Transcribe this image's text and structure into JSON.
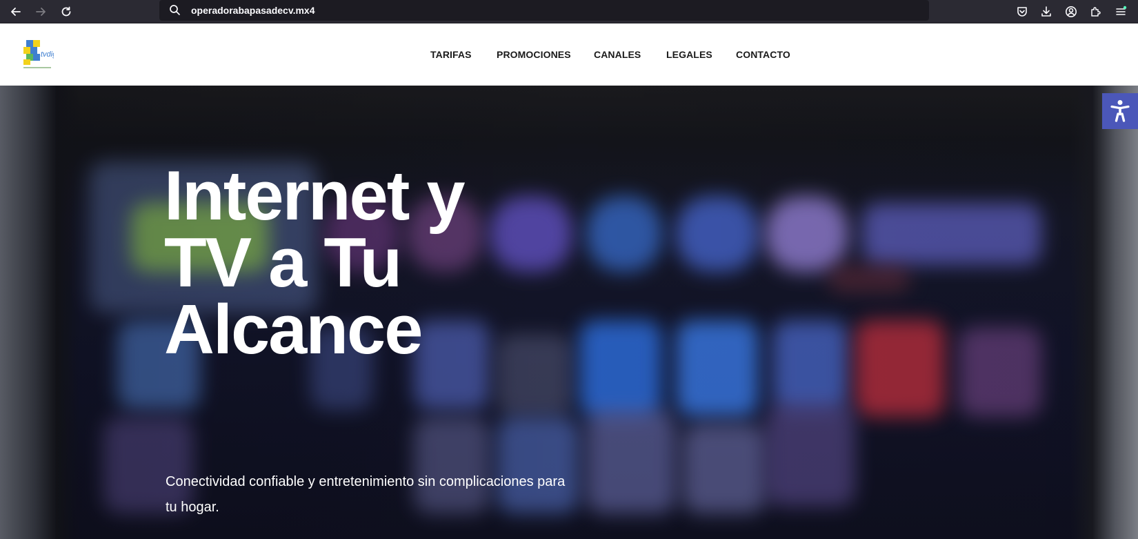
{
  "browser": {
    "url": "operadorabapasadecv.mx4",
    "icons": [
      "back-arrow-icon",
      "forward-arrow-icon",
      "reload-icon",
      "search-icon",
      "pocket-icon",
      "download-icon",
      "account-icon",
      "extensions-icon",
      "menu-icon"
    ]
  },
  "header": {
    "logo_alt": "tvdig",
    "nav": [
      {
        "label": "TARIFAS"
      },
      {
        "label": "PROMOCIONES"
      },
      {
        "label": "CANALES"
      },
      {
        "label": "LEGALES"
      },
      {
        "label": "CONTACTO"
      }
    ]
  },
  "hero": {
    "title_line1": "Internet y",
    "title_line2": "TV a Tu",
    "title_line3": "Alcance",
    "subtitle": "Conectividad confiable y entretenimiento sin complicaciones para tu hogar."
  },
  "accessibility": {
    "icon": "accessibility-icon",
    "color": "#4b57b9"
  }
}
